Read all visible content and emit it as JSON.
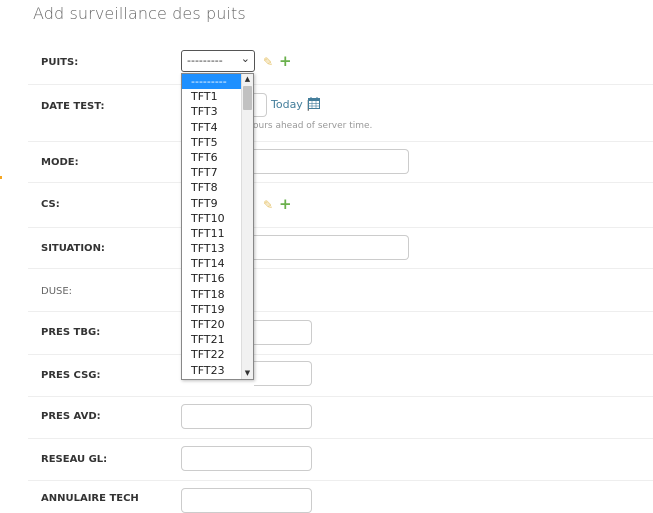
{
  "page": {
    "title": "Add surveillance des puits"
  },
  "form": {
    "puits_label": "PUITS:",
    "puits_value": "---------",
    "date_test_label": "DATE TEST:",
    "today_link": "Today",
    "separator": "|",
    "timezone_note": "ours ahead of server time.",
    "mode_label": "MODE:",
    "cs_label": "CS:",
    "situation_label": "SITUATION:",
    "duse_label": "DUSE:",
    "pres_tbg_label": "PRES TBG:",
    "pres_csg_label": "PRES CSG:",
    "pres_avd_label": "PRES AVD:",
    "reseau_gl_label": "RESEAU GL:",
    "annular_label": "ANNULAIRE TECH"
  },
  "dropdown": {
    "options": [
      "---------",
      "TFT1",
      "TFT3",
      "TFT4",
      "TFT5",
      "TFT6",
      "TFT7",
      "TFT8",
      "TFT9",
      "TFT10",
      "TFT11",
      "TFT13",
      "TFT14",
      "TFT16",
      "TFT18",
      "TFT19",
      "TFT20",
      "TFT21",
      "TFT22",
      "TFT23"
    ],
    "selected_index": 0
  },
  "icons": {
    "edit": "pencil-icon",
    "add": "plus-icon",
    "calendar": "calendar-icon"
  },
  "colors": {
    "link": "#447e9b",
    "add": "#6ab04c",
    "edit": "#e6c36b",
    "selection": "#1e90ff"
  }
}
